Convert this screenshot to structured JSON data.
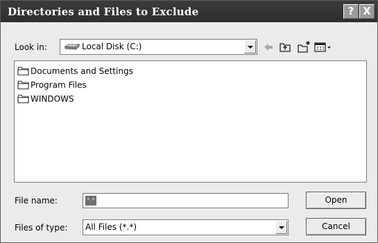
{
  "window": {
    "title": "Directories and Files to Exclude",
    "help": "?",
    "close": "X"
  },
  "look_in": {
    "label": "Look in:",
    "value": "Local Disk (C:)"
  },
  "files": [
    {
      "name": "Documents and Settings"
    },
    {
      "name": "Program Files"
    },
    {
      "name": "WINDOWS"
    }
  ],
  "file_name": {
    "label": "File name:",
    "value": "*.*"
  },
  "files_of_type": {
    "label": "Files of type:",
    "value": "All Files (*.*)"
  },
  "buttons": {
    "open": "Open",
    "cancel": "Cancel"
  },
  "toolbar_icons": [
    "back-arrow-icon",
    "up-one-level-icon",
    "new-folder-icon",
    "view-menu-icon"
  ]
}
